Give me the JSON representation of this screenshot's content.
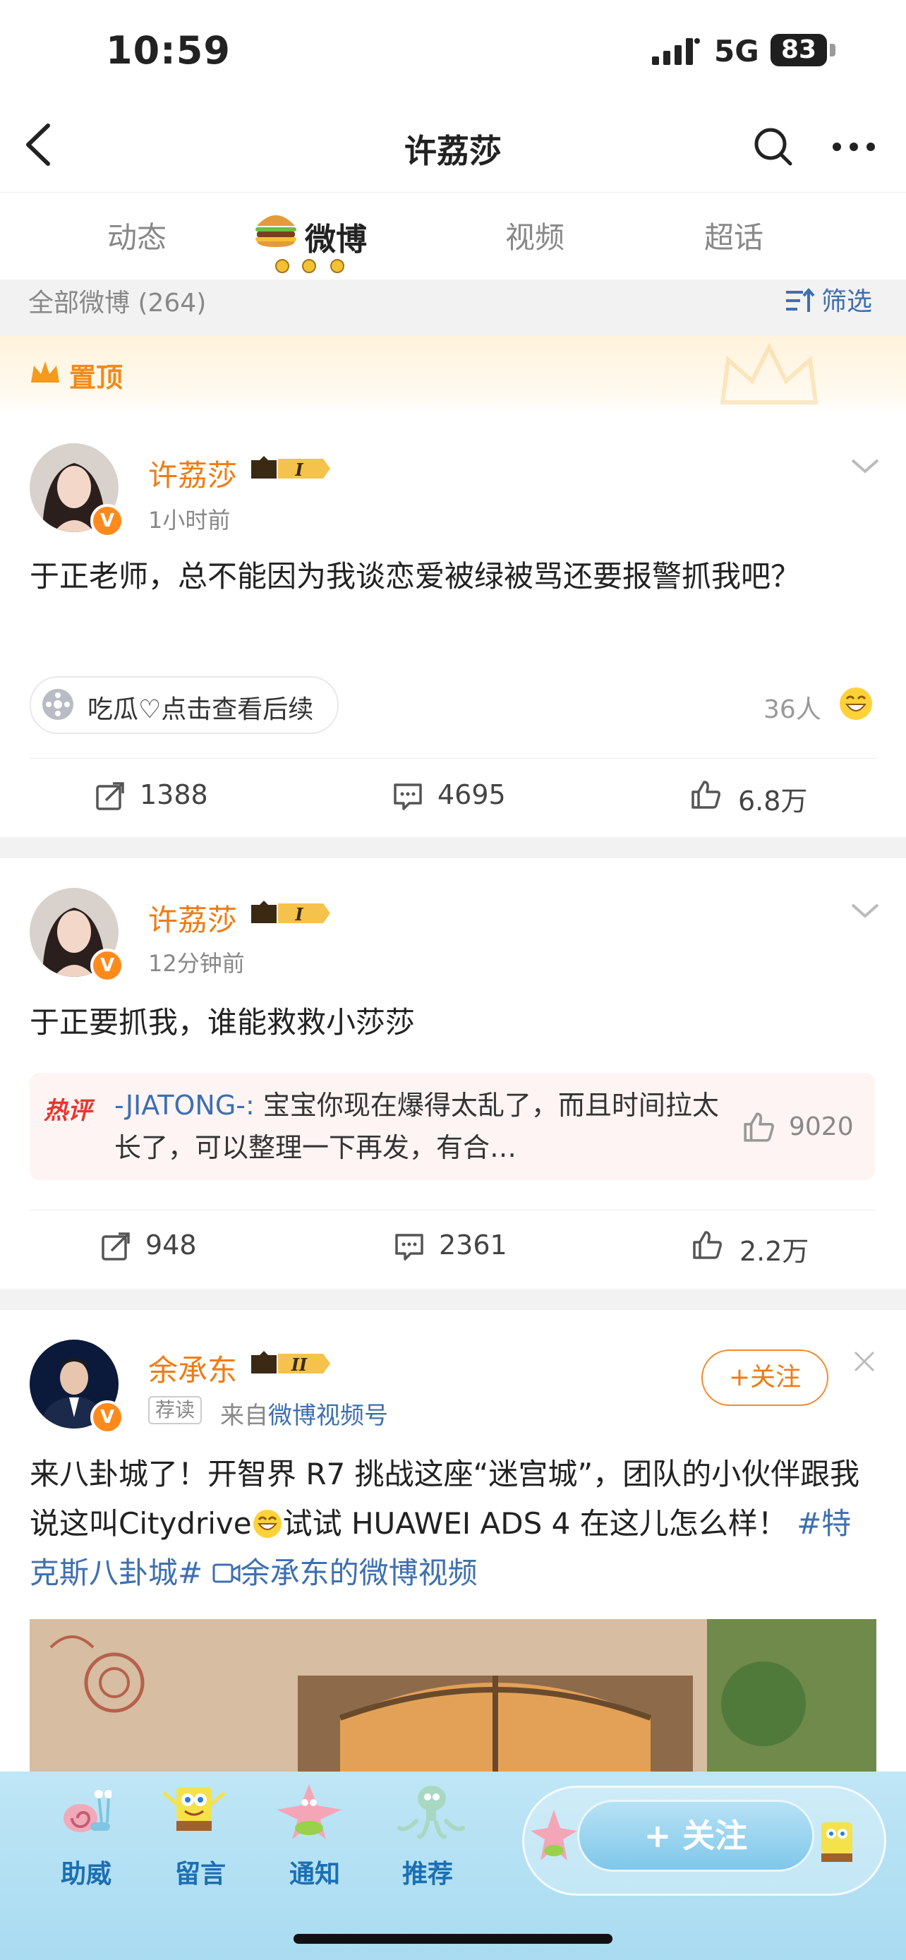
{
  "status_bar": {
    "time": "10:59",
    "network": "5G",
    "battery": "83"
  },
  "nav": {
    "title": "许荔莎"
  },
  "tabs": [
    {
      "label": "动态"
    },
    {
      "label": "微博"
    },
    {
      "label": "视频"
    },
    {
      "label": "超话"
    }
  ],
  "filter_bar": {
    "all_count": "全部微博 (264)",
    "filter_label": "筛选"
  },
  "pinned_label": "置顶",
  "posts": [
    {
      "author": "许荔莎",
      "time": "1小时前",
      "content": "于正老师，总不能因为我谈恋爱被绿被骂还要报警抓我吧？",
      "tag": "吃瓜♡点击查看后续",
      "people": "36人",
      "reposts": "1388",
      "comments": "4695",
      "likes": "6.8万"
    },
    {
      "author": "许荔莎",
      "time": "12分钟前",
      "content": "于正要抓我，谁能救救小莎莎",
      "hot_comment": {
        "tag": "热评",
        "user": "-JIATONG-:",
        "text": " 宝宝你现在爆得太乱了，而且时间拉太长了，可以整理一下再发，有合…",
        "likes": "9020"
      },
      "reposts": "948",
      "comments": "2361",
      "likes": "2.2万"
    },
    {
      "author": "余承东",
      "rec_tag": "荐读",
      "source": "来自",
      "source_link": "微博视频号",
      "follow_label": "+关注",
      "content_a": "来八卦城了！开智界 R7 挑战这座“迷宫城”，团队的小伙伴跟我说这叫Citydrive",
      "content_b": "试试 HUAWEI ADS 4 在这儿怎么样！",
      "hashtag": "#特克斯八卦城#",
      "video_link": "余承东的微博视频"
    }
  ],
  "bottom_bar": {
    "items": [
      {
        "label": "助威"
      },
      {
        "label": "留言"
      },
      {
        "label": "通知"
      },
      {
        "label": "推荐"
      }
    ],
    "follow_label": "+ 关注"
  },
  "colors": {
    "accent": "#f07b13",
    "link": "#3e6fb0",
    "hot": "#e8362d",
    "bottom_bg": "#a9dbf1"
  }
}
